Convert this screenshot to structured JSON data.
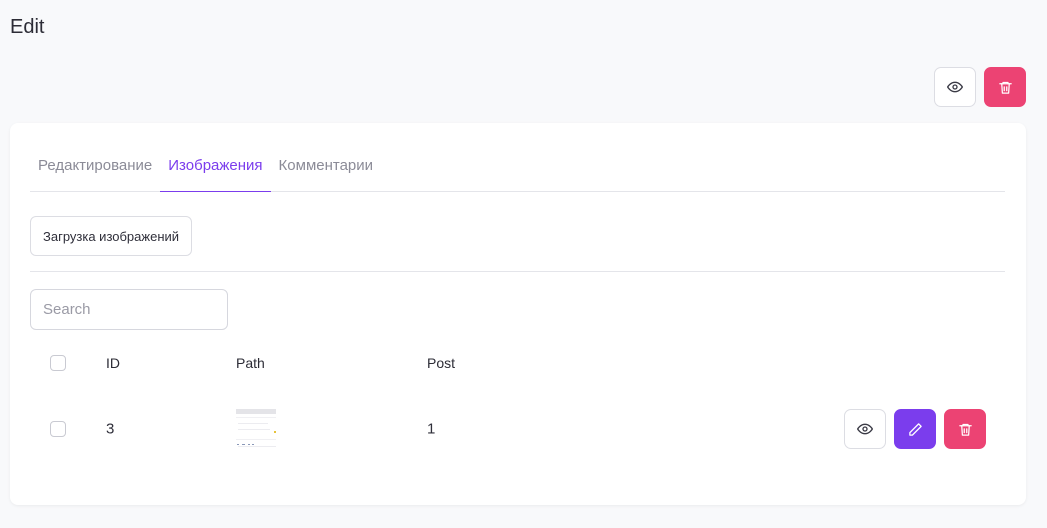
{
  "page": {
    "title": "Edit"
  },
  "top_actions": {
    "view_icon": "eye-icon",
    "delete_icon": "trash-icon"
  },
  "tabs": [
    {
      "label": "Редактирование",
      "active": false
    },
    {
      "label": "Изображения",
      "active": true
    },
    {
      "label": "Комментарии",
      "active": false
    }
  ],
  "upload": {
    "label": "Загрузка изображений"
  },
  "search": {
    "placeholder": "Search",
    "value": ""
  },
  "table": {
    "headers": {
      "id": "ID",
      "path": "Path",
      "post": "Post"
    },
    "rows": [
      {
        "id": "3",
        "post": "1",
        "thumbnail": "image-thumbnail"
      }
    ]
  },
  "colors": {
    "accent": "#7b3ded",
    "danger": "#ec4373",
    "background": "#f8f9fb"
  }
}
